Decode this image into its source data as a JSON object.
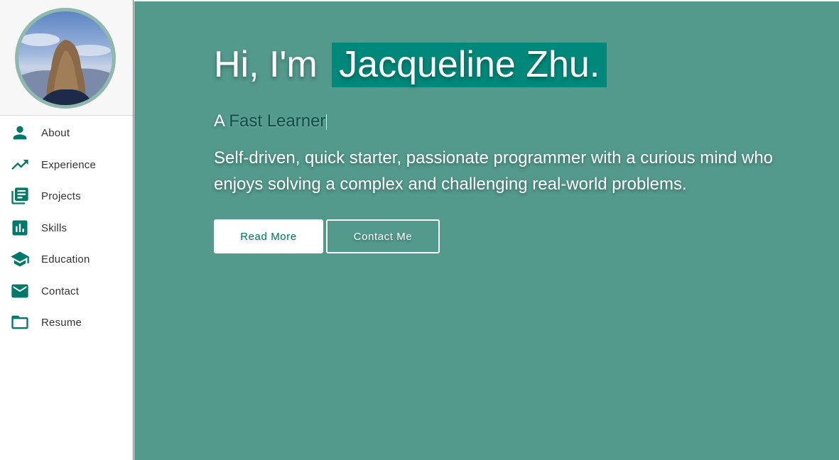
{
  "sidebar": {
    "avatar_alt": "Profile photo",
    "items": [
      {
        "label": "About",
        "icon": "person-icon"
      },
      {
        "label": "Experience",
        "icon": "trending-up-icon"
      },
      {
        "label": "Projects",
        "icon": "library-books-icon"
      },
      {
        "label": "Skills",
        "icon": "bar-chart-icon"
      },
      {
        "label": "Education",
        "icon": "school-icon"
      },
      {
        "label": "Contact",
        "icon": "mail-icon"
      },
      {
        "label": "Resume",
        "icon": "folder-icon"
      }
    ]
  },
  "hero": {
    "greeting": "Hi, I'm",
    "name": "Jacqueline Zhu.",
    "tagline_prefix": "A",
    "tagline_typed": "Fast Learner",
    "bio": "Self-driven, quick starter, passionate programmer with a curious mind who enjoys solving a complex and challenging real-world problems.",
    "read_more_label": "Read More",
    "contact_label": "Contact Me"
  },
  "colors": {
    "accent": "#00796b",
    "hero_background": "#53998c",
    "name_highlight": "#00897b"
  }
}
